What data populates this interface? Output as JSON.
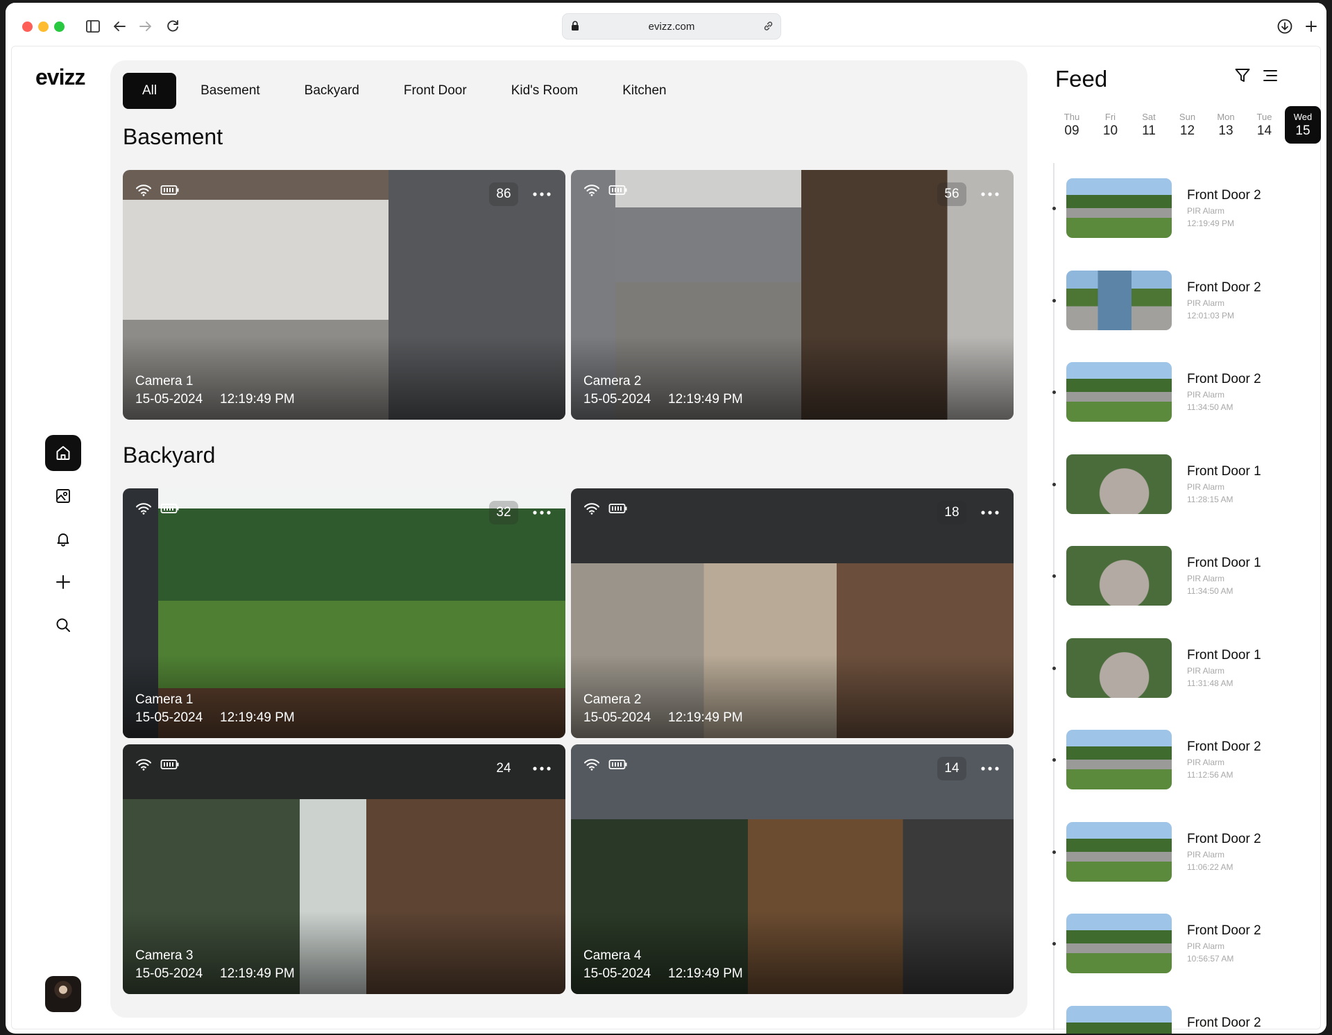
{
  "browser": {
    "url": "evizz.com"
  },
  "app": {
    "logo": "evizz"
  },
  "tabs": [
    "All",
    "Basement",
    "Backyard",
    "Front Door",
    "Kid's Room",
    "Kitchen"
  ],
  "sections": [
    {
      "title": "Basement",
      "cameras": [
        {
          "name": "Camera 1",
          "date": "15-05-2024",
          "time": "12:19:49 PM",
          "count": "86"
        },
        {
          "name": "Camera 2",
          "date": "15-05-2024",
          "time": "12:19:49 PM",
          "count": "56"
        }
      ]
    },
    {
      "title": "Backyard",
      "cameras": [
        {
          "name": "Camera 1",
          "date": "15-05-2024",
          "time": "12:19:49 PM",
          "count": "32"
        },
        {
          "name": "Camera 2",
          "date": "15-05-2024",
          "time": "12:19:49 PM",
          "count": "18"
        },
        {
          "name": "Camera 3",
          "date": "15-05-2024",
          "time": "12:19:49 PM",
          "count": "24"
        },
        {
          "name": "Camera 4",
          "date": "15-05-2024",
          "time": "12:19:49 PM",
          "count": "14"
        }
      ]
    }
  ],
  "feed": {
    "title": "Feed",
    "days": [
      {
        "name": "Thu",
        "num": "09"
      },
      {
        "name": "Fri",
        "num": "10"
      },
      {
        "name": "Sat",
        "num": "11"
      },
      {
        "name": "Sun",
        "num": "12"
      },
      {
        "name": "Mon",
        "num": "13"
      },
      {
        "name": "Tue",
        "num": "14"
      },
      {
        "name": "Wed",
        "num": "15"
      }
    ],
    "items": [
      {
        "name": "Front Door 2",
        "type": "PIR Alarm",
        "time": "12:19:49 PM"
      },
      {
        "name": "Front Door 2",
        "type": "PIR Alarm",
        "time": "12:01:03 PM"
      },
      {
        "name": "Front Door 2",
        "type": "PIR Alarm",
        "time": "11:34:50 AM"
      },
      {
        "name": "Front Door 1",
        "type": "PIR Alarm",
        "time": "11:28:15 AM"
      },
      {
        "name": "Front Door 1",
        "type": "PIR Alarm",
        "time": "11:34:50 AM"
      },
      {
        "name": "Front Door 1",
        "type": "PIR Alarm",
        "time": "11:31:48 AM"
      },
      {
        "name": "Front Door 2",
        "type": "PIR Alarm",
        "time": "11:12:56 AM"
      },
      {
        "name": "Front Door 2",
        "type": "PIR Alarm",
        "time": "11:06:22 AM"
      },
      {
        "name": "Front Door 2",
        "type": "PIR Alarm",
        "time": "10:56:57 AM"
      },
      {
        "name": "Front Door 2",
        "type": "",
        "time": ""
      }
    ]
  },
  "icons": {
    "sidebar": [
      "home-icon",
      "gallery-icon",
      "bell-icon",
      "plus-icon",
      "search-icon"
    ]
  }
}
